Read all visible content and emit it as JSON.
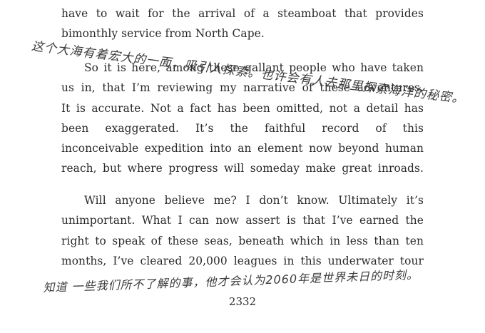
{
  "document": {
    "paragraphs": [
      {
        "lines": [
          "have to wait for the arrival of a steamboat that provides",
          "bimonthly service from North Cape."
        ]
      },
      {
        "lines": [
          "So it is here, among these gallant people who have taken",
          "us in, that I’m reviewing my narrative of these adventures.",
          "It is accurate. Not a fact has been omitted, not a detail has",
          "been exaggerated. It’s the faithful record of this",
          "inconceivable expedition into an element now beyond human",
          "reach, but where progress will someday make great inroads."
        ]
      },
      {
        "lines": [
          "Will anyone believe me? I don’t know. Ultimately it’s",
          "unimportant. What I can now assert is that I’ve earned the",
          "right to speak of these seas, beneath which in less than ten",
          "months, I’ve cleared 20,000 leagues in this underwater tour"
        ]
      }
    ],
    "page_number": "2332"
  },
  "annotations": {
    "handwriting_top": "这个大海有着宏大的一面，吸引人探索。也许会有人去那里探索海洋的秘密。",
    "handwriting_bottom": "知道 一些我们所不了解的事，他才会认为2060年是世界未日的时刻。"
  }
}
